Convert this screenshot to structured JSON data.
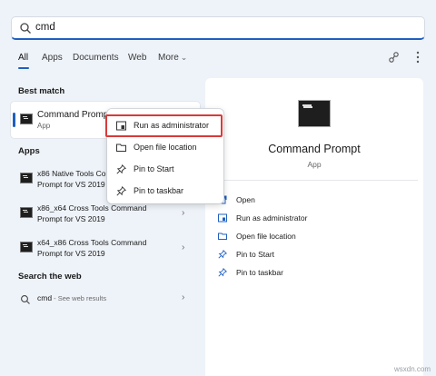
{
  "search": {
    "value": "cmd"
  },
  "tabs": [
    {
      "label": "All"
    },
    {
      "label": "Apps"
    },
    {
      "label": "Documents"
    },
    {
      "label": "Web"
    },
    {
      "label": "More"
    }
  ],
  "left": {
    "best_match_heading": "Best match",
    "best": {
      "title": "Command Prompt",
      "subtitle": "App"
    },
    "apps_heading": "Apps",
    "apps": [
      {
        "line1": "x86 Native Tools Command",
        "line2": "Prompt for VS 2019"
      },
      {
        "line1": "x86_x64 Cross Tools Command",
        "line2": "Prompt for VS 2019"
      },
      {
        "line1": "x64_x86 Cross Tools Command",
        "line2": "Prompt for VS 2019"
      }
    ],
    "web_heading": "Search the web",
    "web": {
      "query": "cmd",
      "suffix": " - See web results"
    }
  },
  "context_menu": [
    {
      "label": "Run as administrator",
      "icon": "shield-window-icon"
    },
    {
      "label": "Open file location",
      "icon": "folder-icon"
    },
    {
      "label": "Pin to Start",
      "icon": "pin-icon"
    },
    {
      "label": "Pin to taskbar",
      "icon": "pin-icon"
    }
  ],
  "right": {
    "title": "Command Prompt",
    "subtitle": "App",
    "actions": [
      {
        "label": "Open",
        "icon": "open-icon"
      },
      {
        "label": "Run as administrator",
        "icon": "shield-window-icon"
      },
      {
        "label": "Open file location",
        "icon": "folder-icon"
      },
      {
        "label": "Pin to Start",
        "icon": "pin-icon"
      },
      {
        "label": "Pin to taskbar",
        "icon": "pin-icon"
      }
    ]
  },
  "watermark": "wsxdn.com",
  "colors": {
    "accent": "#1f5fbf",
    "highlight": "#d93a3a",
    "panel": "#ffffff",
    "background": "#eef3f9"
  }
}
